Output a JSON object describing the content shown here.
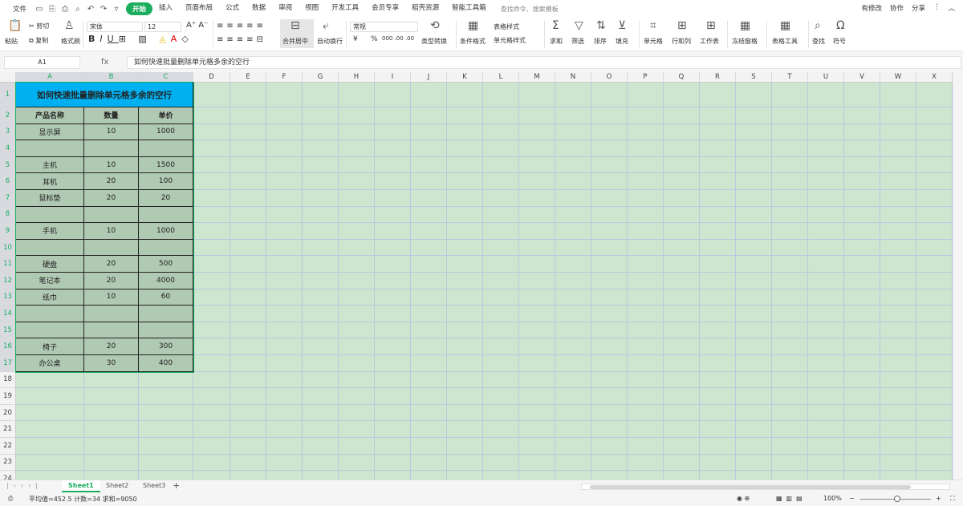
{
  "menu": {
    "file": "文件",
    "tabs": [
      "开始",
      "插入",
      "页面布局",
      "公式",
      "数据",
      "审阅",
      "视图",
      "开发工具",
      "会员专享",
      "稻壳资源",
      "智能工具箱"
    ],
    "active": "开始",
    "search_placeholder": "查找命令、搜索模板",
    "right": [
      "有修改",
      "协作",
      "分享"
    ]
  },
  "ribbon": {
    "paste": "粘贴",
    "cut": "剪切",
    "copy": "复制",
    "format_painter": "格式刷",
    "font": "宋体",
    "size": "12",
    "merge": "合并居中",
    "wrap": "自动换行",
    "number_format": "常规",
    "convert": "类型转换",
    "cond_format": "条件格式",
    "table_style": "表格样式",
    "cell_style": "单元格样式",
    "sum": "求和",
    "filter": "筛选",
    "sort": "排序",
    "fill": "填充",
    "cell": "单元格",
    "rowcol": "行和列",
    "sheet": "工作表",
    "freeze": "冻结窗格",
    "table_tools": "表格工具",
    "find": "查找",
    "symbol": "符号",
    "currency": "¥",
    "percent": "%"
  },
  "formula_bar": {
    "name_box": "A1",
    "fx": "fx",
    "value": "如何快速批量删除单元格多余的空行"
  },
  "columns": [
    "A",
    "B",
    "C",
    "D",
    "E",
    "F",
    "G",
    "H",
    "I",
    "J",
    "K",
    "L",
    "M",
    "N",
    "O",
    "P",
    "Q",
    "R",
    "S",
    "T",
    "U",
    "V",
    "W",
    "X"
  ],
  "table": {
    "title": "如何快速批量删除单元格多余的空行",
    "headers": [
      "产品名称",
      "数量",
      "单价"
    ],
    "rows": [
      [
        "显示屏",
        "10",
        "1000"
      ],
      [
        "",
        "",
        ""
      ],
      [
        "主机",
        "10",
        "1500"
      ],
      [
        "耳机",
        "20",
        "100"
      ],
      [
        "鼠标垫",
        "20",
        "20"
      ],
      [
        "",
        "",
        ""
      ],
      [
        "手机",
        "10",
        "1000"
      ],
      [
        "",
        "",
        ""
      ],
      [
        "硬盘",
        "20",
        "500"
      ],
      [
        "笔记本",
        "20",
        "4000"
      ],
      [
        "纸巾",
        "10",
        "60"
      ],
      [
        "",
        "",
        ""
      ],
      [
        "",
        "",
        ""
      ],
      [
        "椅子",
        "20",
        "300"
      ],
      [
        "办公桌",
        "30",
        "400"
      ]
    ]
  },
  "sheets": [
    "Sheet1",
    "Sheet2",
    "Sheet3"
  ],
  "active_sheet": "Sheet1",
  "status": {
    "summary": "平均值=452.5  计数=34  求和=9050",
    "zoom": "100%"
  },
  "colors": {
    "accent": "#1aad5e",
    "title_fill": "#00b0f0",
    "table_fill": "#b0c9b2",
    "sheet_bg": "#cde6cf"
  }
}
